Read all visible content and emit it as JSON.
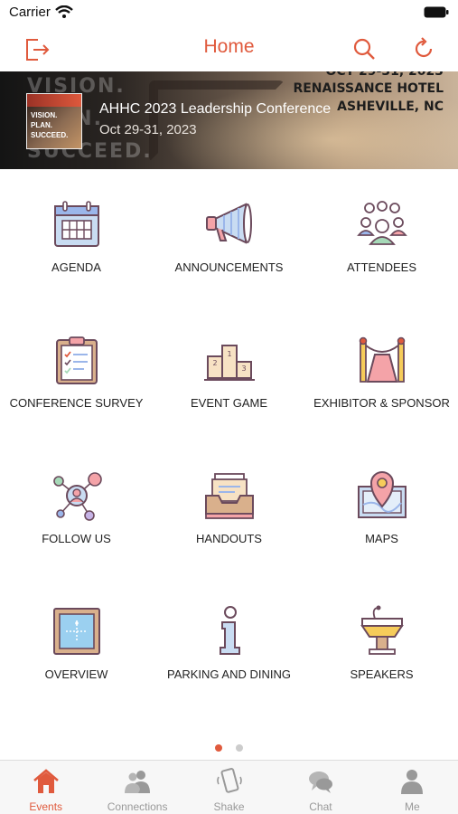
{
  "status_bar": {
    "carrier": "Carrier"
  },
  "nav": {
    "title": "Home"
  },
  "banner": {
    "bg_words": [
      "VISION.",
      "PLAN.",
      "SUCCEED."
    ],
    "venue_date": "OCT 29-31, 2023",
    "venue_lines": [
      "RENAISSANCE HOTEL",
      "ASHEVILLE, NC"
    ],
    "thumb_text": [
      "VISION.",
      "PLAN.",
      "SUCCEED."
    ],
    "title": "AHHC 2023 Leadership Conference",
    "date": "Oct 29-31, 2023"
  },
  "tiles": [
    {
      "label": "AGENDA",
      "icon": "calendar-icon"
    },
    {
      "label": "ANNOUNCEMENTS",
      "icon": "megaphone-icon"
    },
    {
      "label": "ATTENDEES",
      "icon": "people-group-icon"
    },
    {
      "label": "CONFERENCE SURVEY",
      "icon": "clipboard-icon"
    },
    {
      "label": "EVENT GAME",
      "icon": "podium-icon"
    },
    {
      "label": "EXHIBITOR & SPONSOR",
      "icon": "red-carpet-icon"
    },
    {
      "label": "FOLLOW US",
      "icon": "social-network-icon"
    },
    {
      "label": "HANDOUTS",
      "icon": "inbox-tray-icon"
    },
    {
      "label": "MAPS",
      "icon": "map-pin-icon"
    },
    {
      "label": "OVERVIEW",
      "icon": "info-board-icon"
    },
    {
      "label": "PARKING AND DINING",
      "icon": "info-icon"
    },
    {
      "label": "SPEAKERS",
      "icon": "lectern-icon"
    }
  ],
  "pagination": {
    "active_color": "#e05a3d",
    "inactive_color": "#cccccc"
  },
  "tabs": [
    {
      "label": "Events",
      "icon": "home-icon",
      "active": true
    },
    {
      "label": "Connections",
      "icon": "connections-icon",
      "active": false
    },
    {
      "label": "Shake",
      "icon": "phone-shake-icon",
      "active": false
    },
    {
      "label": "Chat",
      "icon": "chat-bubbles-icon",
      "active": false
    },
    {
      "label": "Me",
      "icon": "person-icon",
      "active": false
    }
  ],
  "colors": {
    "accent": "#e05a3d",
    "icon_outline": "#6b4a5c"
  }
}
